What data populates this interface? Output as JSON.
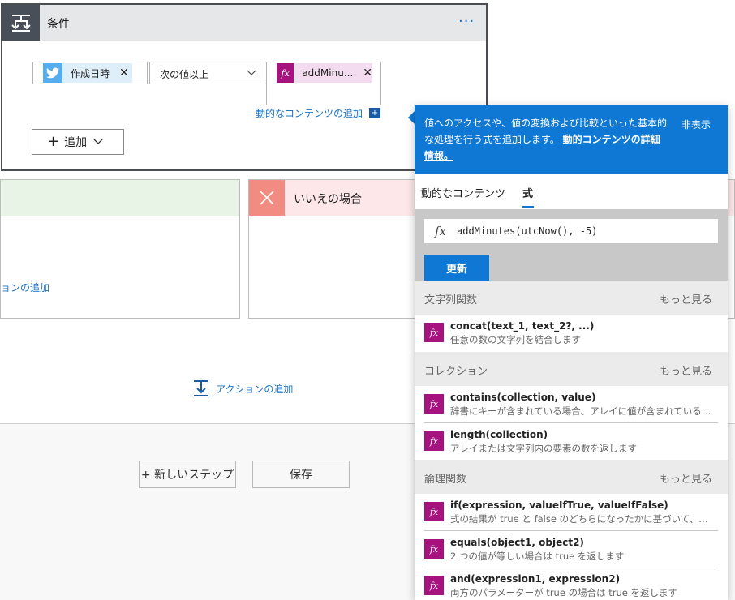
{
  "condition": {
    "title": "条件",
    "more": "···",
    "left_token": "作成日時",
    "operator": "次の値以上",
    "right_token": "addMinu...",
    "fx_label": "fx",
    "add_dynamic": "動的なコンテンツの追加",
    "add_button": "追加"
  },
  "branches": {
    "yes_link": "ョンの追加",
    "no_title": "いいえの場合"
  },
  "add_action": "アクションの追加",
  "bottom": {
    "new_step": "+ 新しいステップ",
    "save": "保存"
  },
  "popup": {
    "info_text": "値へのアクセスや、値の変換および比較といった基本的な処理を行う式を追加します。",
    "info_link": "動的コンテンツの詳細情報。",
    "hide": "非表示",
    "tabs": [
      "動的なコンテンツ",
      "式"
    ],
    "fx_symbol": "fx",
    "expression": "addMinutes(utcNow(), -5)",
    "update": "更新",
    "more_label": "もっと見る",
    "sections": [
      {
        "title": "文字列関数",
        "items": [
          {
            "name": "concat(text_1, text_2?, ...)",
            "desc": "任意の数の文字列を結合します"
          }
        ]
      },
      {
        "title": "コレクション",
        "items": [
          {
            "name": "contains(collection, value)",
            "desc": "辞書にキーが含まれている場合、アレイに値が含まれている場合、または文字列にサブ文字列が含まれている場合に true を返します"
          },
          {
            "name": "length(collection)",
            "desc": "アレイまたは文字列内の要素の数を返します"
          }
        ]
      },
      {
        "title": "論理関数",
        "items": [
          {
            "name": "if(expression, valueIfTrue, valueIfFalse)",
            "desc": "式の結果が true と false のどちらになったかに基づいて、指定された値を返します"
          },
          {
            "name": "equals(object1, object2)",
            "desc": "2 つの値が等しい場合は true を返します"
          },
          {
            "name": "and(expression1, expression2)",
            "desc": "両方のパラメーターが true の場合は true を返します"
          }
        ]
      }
    ]
  },
  "colors": {
    "accent": "#0f78d4",
    "function_badge": "#a6127e",
    "twitter": "#55acee",
    "no_branch": "#f28b82",
    "yes_branch_bg": "#e8f4e6"
  }
}
